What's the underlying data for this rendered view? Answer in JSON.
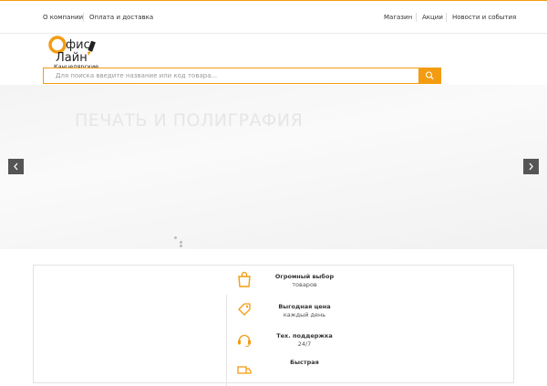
{
  "top_nav": {
    "left": [
      {
        "label": "О компании"
      },
      {
        "label": "Оплата и доставка"
      }
    ],
    "right": [
      {
        "label": "Магазин"
      },
      {
        "label": "Акции"
      },
      {
        "label": "Новости и события"
      }
    ]
  },
  "logo": {
    "letter_big": "О",
    "line1_rest": "фис",
    "line2": "Лайн",
    "subtitle": "Канцелярские"
  },
  "search": {
    "placeholder": "Для поиска введите название или код товара..."
  },
  "hero": {
    "title": "ПЕЧАТЬ И ПОЛИГРАФИЯ",
    "slide_count": 2,
    "active_slide": 1
  },
  "features": [
    {
      "title": "Огромный выбор",
      "subtitle": "товаров",
      "icon": "shopping-bag-icon"
    },
    {
      "title": "Выгодная цена",
      "subtitle": "каждый день",
      "icon": "price-tag-icon"
    },
    {
      "title": "Тех. поддержка",
      "subtitle": "24/7",
      "icon": "headset-icon"
    },
    {
      "title": "Быстрая",
      "subtitle": "",
      "icon": "delivery-icon"
    }
  ],
  "colors": {
    "accent": "#f39c12",
    "arrow_bg": "#555555"
  }
}
